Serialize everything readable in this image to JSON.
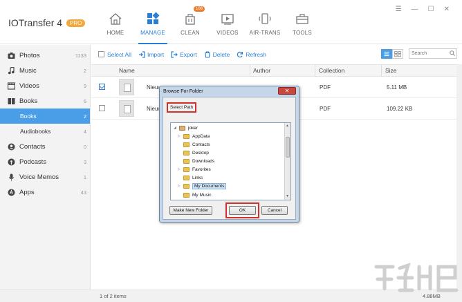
{
  "app": {
    "name": "IOTransfer 4",
    "badge": "PRO"
  },
  "nav": [
    {
      "key": "home",
      "label": "HOME",
      "icon": "home-icon"
    },
    {
      "key": "manage",
      "label": "MANAGE",
      "icon": "grid-icon",
      "active": true
    },
    {
      "key": "clean",
      "label": "CLEAN",
      "icon": "broom-icon",
      "badge": "108"
    },
    {
      "key": "videos",
      "label": "VIDEOS",
      "icon": "video-icon"
    },
    {
      "key": "airtrans",
      "label": "AIR-TRANS",
      "icon": "phone-wifi-icon"
    },
    {
      "key": "tools",
      "label": "TOOLS",
      "icon": "toolbox-icon"
    }
  ],
  "window_controls": {
    "menu": "☰",
    "minimize": "—",
    "maximize": "☐",
    "close": "✕"
  },
  "sidebar": {
    "items": [
      {
        "label": "Photos",
        "count": "1133",
        "icon": "camera-icon"
      },
      {
        "label": "Music",
        "count": "2",
        "icon": "music-note-icon"
      },
      {
        "label": "Videos",
        "count": "9",
        "icon": "film-icon"
      },
      {
        "label": "Books",
        "count": "6",
        "icon": "book-icon"
      },
      {
        "label": "Books",
        "count": "2",
        "sub": true,
        "selected": true
      },
      {
        "label": "Audiobooks",
        "count": "4",
        "sub": true
      },
      {
        "label": "Contacts",
        "count": "0",
        "icon": "contacts-icon"
      },
      {
        "label": "Podcasts",
        "count": "3",
        "icon": "podcast-icon"
      },
      {
        "label": "Voice Memos",
        "count": "1",
        "icon": "microphone-icon"
      },
      {
        "label": "Apps",
        "count": "43",
        "icon": "apps-icon"
      }
    ]
  },
  "toolbar": {
    "select_all": "Select All",
    "import": "Import",
    "export": "Export",
    "delete": "Delete",
    "refresh": "Refresh",
    "search_placeholder": "Search"
  },
  "table": {
    "columns": {
      "name": "Name",
      "author": "Author",
      "collection": "Collection",
      "size": "Size"
    },
    "rows": [
      {
        "checked": true,
        "name": "Nieuw",
        "collection": "PDF",
        "size": "5.11 MB"
      },
      {
        "checked": false,
        "name": "Nieuw",
        "collection": "PDF",
        "size": "109.22 KB"
      }
    ]
  },
  "footer": {
    "items": "1 of 2 items",
    "size": "4.88MB"
  },
  "dialog": {
    "title": "Browse For Folder",
    "close": "✕",
    "prompt": "Select Path",
    "tree": [
      {
        "label": "joker",
        "level": 0,
        "expander": "◢",
        "icon": "user-folder-icon"
      },
      {
        "label": "AppData",
        "level": 1,
        "expander": "▷",
        "icon": "folder-icon"
      },
      {
        "label": "Contacts",
        "level": 1,
        "expander": "",
        "icon": "folder-icon"
      },
      {
        "label": "Desktop",
        "level": 1,
        "expander": "",
        "icon": "folder-icon"
      },
      {
        "label": "Downloads",
        "level": 1,
        "expander": "",
        "icon": "folder-icon"
      },
      {
        "label": "Favorites",
        "level": 1,
        "expander": "▷",
        "icon": "folder-icon"
      },
      {
        "label": "Links",
        "level": 1,
        "expander": "",
        "icon": "folder-icon"
      },
      {
        "label": "My Documents",
        "level": 1,
        "expander": "▷",
        "icon": "folder-icon",
        "selected": true
      },
      {
        "label": "My Music",
        "level": 1,
        "expander": "",
        "icon": "folder-icon"
      }
    ],
    "buttons": {
      "new_folder": "Make New Folder",
      "ok": "OK",
      "cancel": "Cancel"
    }
  },
  "colors": {
    "accent": "#2a7fd4",
    "selected_bg": "#4a9ee8",
    "badge": "#f2a93b",
    "highlight": "#d0302a"
  }
}
